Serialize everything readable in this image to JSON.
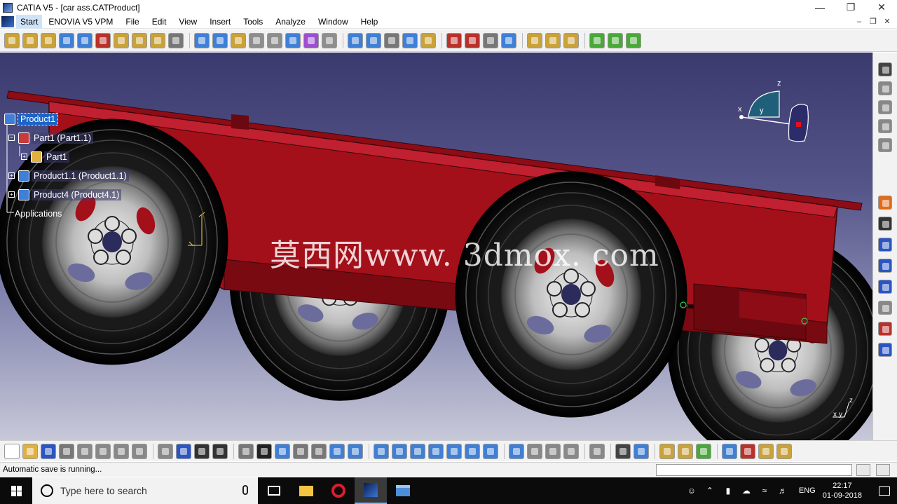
{
  "window": {
    "title": "CATIA V5 - [car ass.CATProduct]",
    "buttons": {
      "minimize": "—",
      "maximize": "❐",
      "close": "✕"
    }
  },
  "menu": {
    "items": [
      "Start",
      "ENOVIA V5 VPM",
      "File",
      "Edit",
      "View",
      "Insert",
      "Tools",
      "Analyze",
      "Window",
      "Help"
    ],
    "mdi_buttons": [
      "–",
      "❐",
      "✕"
    ]
  },
  "toolbar_top": {
    "icon_colors": [
      "#c9a23a",
      "#c9a23a",
      "#c9a23a",
      "#3f7fd6",
      "#3f7fd6",
      "#b8322b",
      "#c9a23a",
      "#c9a23a",
      "#c9a23a",
      "#777777",
      "#3f7fd6",
      "#3f7fd6",
      "#c9a23a",
      "#8e8e8e",
      "#8e8e8e",
      "#3f7fd6",
      "#9c4fd0",
      "#8e8e8e",
      "#3f7fd6",
      "#3f7fd6",
      "#777777",
      "#3f7fd6",
      "#c9a23a",
      "#b8322b",
      "#b8322b",
      "#777777",
      "#3f7fd6",
      "#c9a23a",
      "#c9a23a",
      "#c9a23a",
      "#4aa83a",
      "#4aa83a",
      "#4aa83a"
    ],
    "separators_after": [
      10,
      18,
      23,
      27,
      30
    ]
  },
  "toolbar_bottom": {
    "icon_colors": [
      "#ffffff",
      "#e0b040",
      "#2a55c2",
      "#777777",
      "#888888",
      "#888888",
      "#888888",
      "#888888",
      "#888888",
      "#2a55c2",
      "#333333",
      "#333333",
      "#777777",
      "#222222",
      "#3f7fd6",
      "#777777",
      "#777777",
      "#3f7fd6",
      "#3f7fd6",
      "#3f7fd6",
      "#3f7fd6",
      "#3f7fd6",
      "#3f7fd6",
      "#3f7fd6",
      "#3f7fd6",
      "#3f7fd6",
      "#3f7fd6",
      "#888888",
      "#888888",
      "#888888",
      "#888888",
      "#444444",
      "#3f7fd6",
      "#c9a23a",
      "#c9a23a",
      "#4aa83a",
      "#3f7fd6",
      "#b8322b",
      "#c9a23a",
      "#c9a23a"
    ],
    "separators_after": [
      8,
      12,
      19,
      26,
      30,
      31,
      33,
      36
    ]
  },
  "right_toolbar": {
    "icon_colors": [
      "#444444",
      "#888888",
      "#888888",
      "#888888",
      "#888888",
      "#e06b1a",
      "#333333",
      "#2a55c2",
      "#2a55c2",
      "#2a55c2",
      "#888888",
      "#b8322b",
      "#2a55c2"
    ]
  },
  "spec_tree": {
    "nodes": [
      {
        "label": "Product1",
        "state": "selected"
      },
      {
        "label": "Part1 (Part1.1)",
        "state": "boxed"
      },
      {
        "label": "Part1",
        "state": "boxed"
      },
      {
        "label": "Product1.1 (Product1.1)",
        "state": "boxed"
      },
      {
        "label": "Product4 (Product4.1)",
        "state": "boxed"
      },
      {
        "label": "Applications",
        "state": "plain"
      }
    ]
  },
  "watermark": "莫西网www. 3dmox. com",
  "compass": {
    "x": "x",
    "y": "y",
    "z": "z"
  },
  "axis_triad": {
    "x": "x",
    "y": "y",
    "z": "z"
  },
  "status": {
    "message": "Automatic save is running..."
  },
  "taskbar": {
    "search_placeholder": "Type here to search",
    "language": "ENG",
    "time": "22:17",
    "date": "01-09-2018"
  },
  "colors": {
    "viewport_top": "#3a3a6e",
    "viewport_bottom": "#c7c8d8",
    "frame": "#a3101a",
    "selection": "#1c63c7"
  }
}
